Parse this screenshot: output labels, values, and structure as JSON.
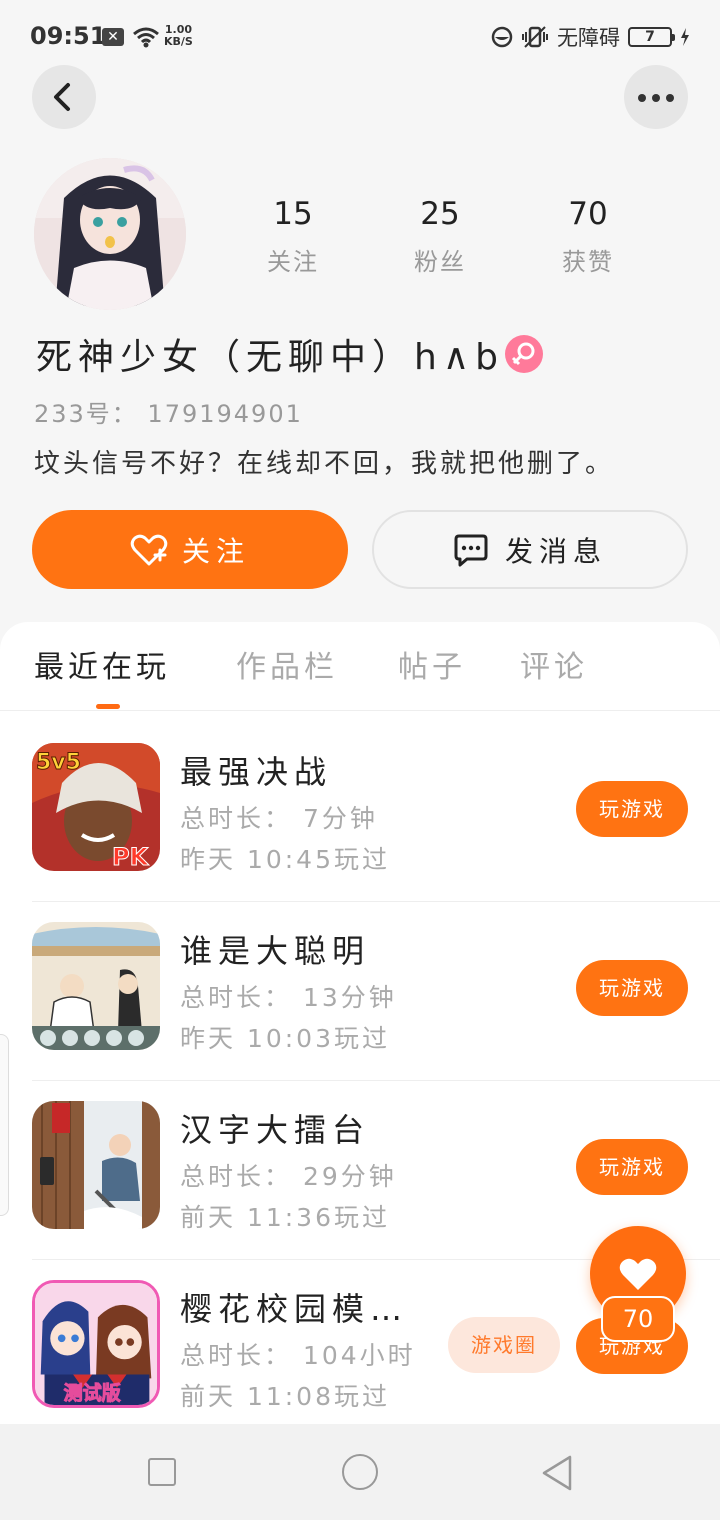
{
  "status_bar": {
    "time": "09:51",
    "net_speed_value": "1.00",
    "net_speed_unit": "KB/S",
    "accessibility": "无障碍",
    "battery": "7"
  },
  "profile": {
    "nickname": "死神少女（无聊中）h∧b",
    "uid": "233号： 179194901",
    "bio": "坟头信号不好？在线却不回，我就把他删了。",
    "stats": [
      {
        "num": "15",
        "label": "关注"
      },
      {
        "num": "25",
        "label": "粉丝"
      },
      {
        "num": "70",
        "label": "获赞"
      }
    ],
    "follow_label": "关注",
    "message_label": "发消息"
  },
  "tabs": [
    "最近在玩",
    "作品栏",
    "帖子",
    "评论"
  ],
  "active_tab": 0,
  "games": [
    {
      "name": "最强决战",
      "duration": "总时长： 7分钟",
      "last_played": "昨天 10:45玩过",
      "play_label": "玩游戏",
      "icon": "game-icon-5v5-pk"
    },
    {
      "name": "谁是大聪明",
      "duration": "总时长： 13分钟",
      "last_played": "昨天 10:03玩过",
      "play_label": "玩游戏",
      "icon": "game-icon-cartoon"
    },
    {
      "name": "汉字大擂台",
      "duration": "总时长： 29分钟",
      "last_played": "前天 11:36玩过",
      "play_label": "玩游戏",
      "icon": "game-icon-door"
    },
    {
      "name": "樱花校园模…",
      "duration": "总时长： 104小时",
      "last_played": "前天 11:08玩过",
      "play_label": "玩游戏",
      "icon": "game-icon-sakura"
    }
  ],
  "game_icon_badges": {
    "top": "5v5",
    "bottom": "PK",
    "sakura": "测试版"
  },
  "floating": {
    "game_circle_label": "游戏圈",
    "like_count": "70"
  },
  "colors": {
    "accent": "#ff7312",
    "female_badge": "#ff7a9a",
    "secondary_text": "#aaaaaa"
  }
}
